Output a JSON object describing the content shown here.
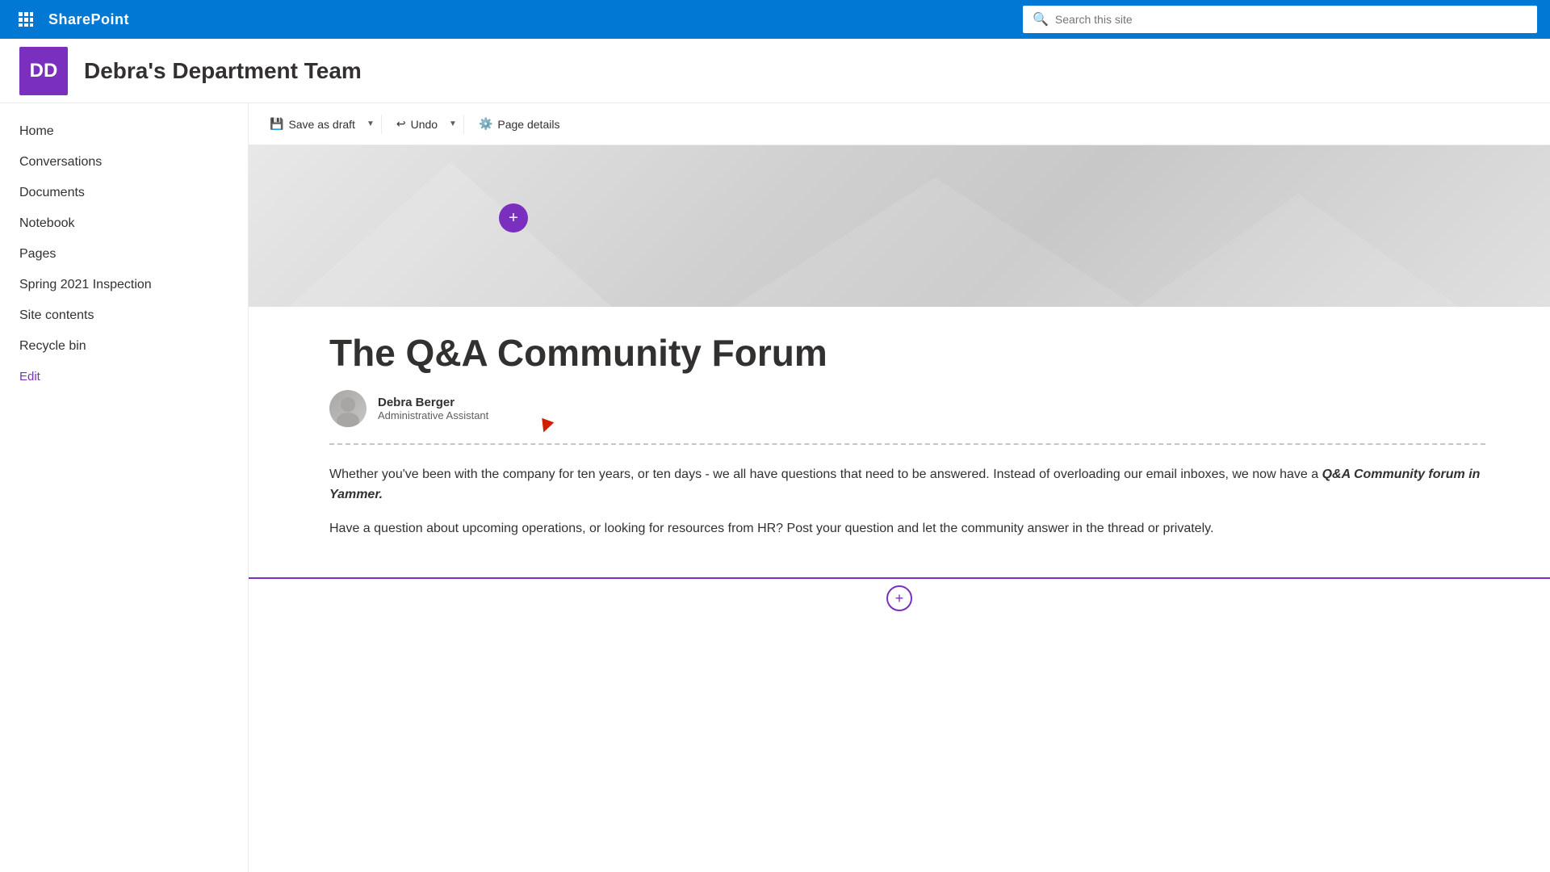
{
  "topnav": {
    "app_name": "SharePoint",
    "search_placeholder": "Search this site"
  },
  "site": {
    "logo_initials": "DD",
    "title": "Debra's Department Team"
  },
  "sidebar": {
    "items": [
      {
        "label": "Home",
        "id": "home"
      },
      {
        "label": "Conversations",
        "id": "conversations"
      },
      {
        "label": "Documents",
        "id": "documents"
      },
      {
        "label": "Notebook",
        "id": "notebook"
      },
      {
        "label": "Pages",
        "id": "pages"
      },
      {
        "label": "Spring 2021 Inspection",
        "id": "spring-inspection"
      },
      {
        "label": "Site contents",
        "id": "site-contents"
      },
      {
        "label": "Recycle bin",
        "id": "recycle-bin"
      },
      {
        "label": "Edit",
        "id": "edit",
        "is_edit": true
      }
    ]
  },
  "toolbar": {
    "save_draft_label": "Save as draft",
    "undo_label": "Undo",
    "page_details_label": "Page details"
  },
  "article": {
    "title": "The Q&A Community Forum",
    "author_name": "Debra Berger",
    "author_role": "Administrative Assistant",
    "paragraph1": "Whether you've been with the company for ten years, or ten days - we all have questions that need to be answered. Instead of overloading our email inboxes, we now have a ",
    "paragraph1_bold": "Q&A Community forum in Yammer.",
    "paragraph2": "Have a question about upcoming operations, or looking for resources from HR?  Post your question and let the community answer in the thread or privately."
  }
}
